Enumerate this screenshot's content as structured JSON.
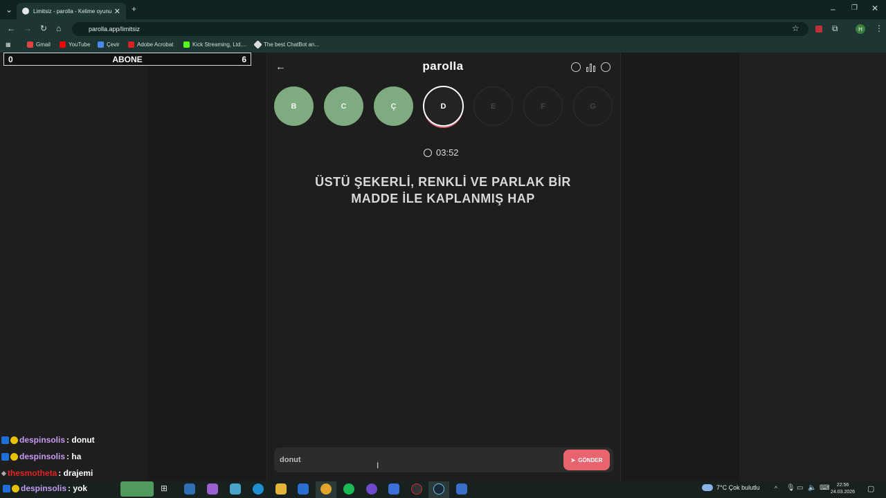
{
  "browser": {
    "tab_title": "Limitsiz - parolla - Kelime oyunu",
    "url": "parolla.app/limitsiz",
    "bookmarks": [
      "Gmail",
      "YouTube",
      "Çevir",
      "Adobe Acrobat",
      "Kick Streaming, Ltd....",
      "The best ChatBot an..."
    ]
  },
  "overlay": {
    "left_value": "0",
    "label": "ABONE",
    "right_value": "6"
  },
  "chat": [
    {
      "user": "despinsolis",
      "message": ": donut"
    },
    {
      "user": "despinsolis",
      "message": ": ha"
    },
    {
      "user": "thesmotheta",
      "message": ": drajemi"
    },
    {
      "user": "despinsolis",
      "message": ": yok"
    }
  ],
  "app": {
    "title": "parolla",
    "letters": [
      {
        "letter": "B",
        "state": "done"
      },
      {
        "letter": "C",
        "state": "done"
      },
      {
        "letter": "Ç",
        "state": "done"
      },
      {
        "letter": "D",
        "state": "current"
      },
      {
        "letter": "E",
        "state": "todo"
      },
      {
        "letter": "F",
        "state": "todo"
      },
      {
        "letter": "G",
        "state": "todo"
      }
    ],
    "timer": "03:52",
    "question_line1": "ÜSTÜ ŞEKERLİ, RENKLİ VE PARLAK BİR",
    "question_line2": "MADDE İLE KAPLANMIŞ HAP",
    "answer_value": "donut",
    "send_label": "GÖNDER"
  },
  "taskbar": {
    "weather": "7°C  Çok bulutlu",
    "time": "22:56",
    "date": "24.03.2026"
  },
  "colors": {
    "done": "#7fab80",
    "send": "#e9646f"
  }
}
